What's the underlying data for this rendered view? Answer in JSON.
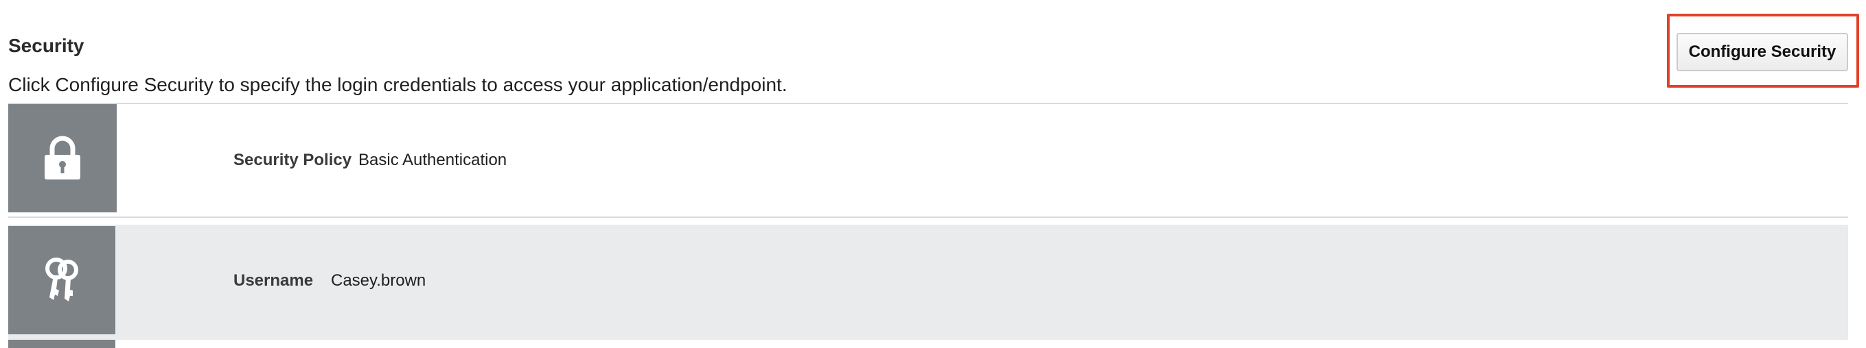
{
  "section": {
    "title": "Security",
    "description": "Click Configure Security to specify the login credentials to access your application/endpoint."
  },
  "toolbar": {
    "configure_label": "Configure Security"
  },
  "rows": [
    {
      "icon": "lock-icon",
      "label": "Security Policy",
      "value": "Basic Authentication"
    },
    {
      "icon": "keys-icon",
      "label": "Username",
      "value": "Casey.brown"
    }
  ],
  "colors": {
    "icon_tile": "#7d8287",
    "highlight": "#e0412b",
    "alt_row": "#e9ebed"
  }
}
